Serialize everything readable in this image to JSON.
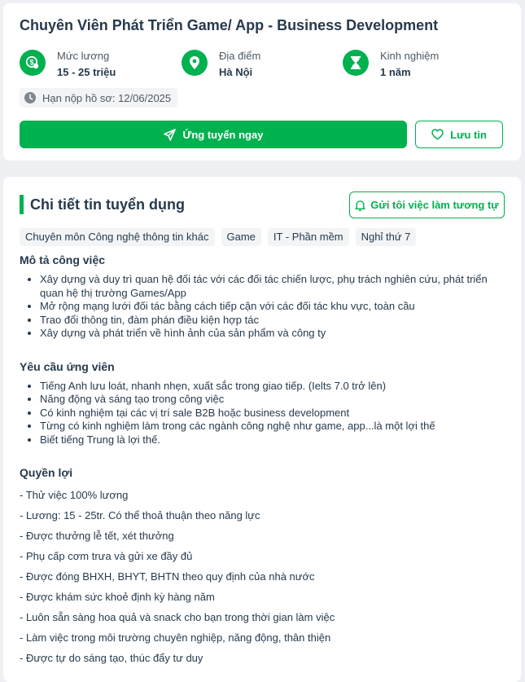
{
  "job": {
    "title": "Chuyên Viên Phát Triển Game/ App - Business Development",
    "salary_label": "Mức lương",
    "salary_value": "15 - 25 triệu",
    "location_label": "Địa điểm",
    "location_value": "Hà Nội",
    "experience_label": "Kinh nghiệm",
    "experience_value": "1 năm",
    "deadline": "Hạn nộp hồ sơ: 12/06/2025",
    "apply_label": "Ứng tuyển ngay",
    "save_label": "Lưu tin"
  },
  "detail": {
    "title": "Chi tiết tin tuyển dụng",
    "notify_label": "Gửi tôi việc làm tương tự",
    "tags": [
      "Chuyên môn Công nghệ thông tin khác",
      "Game",
      "IT - Phần mềm",
      "Nghỉ thứ 7"
    ],
    "description": {
      "heading": "Mô tả công việc",
      "items": [
        "Xây dựng và duy trì quan hệ đối tác với các đối tác chiến lược, phụ trách nghiên cứu, phát triển quan hệ thị trường Games/App",
        "Mở rộng mạng lưới đối tác bằng cách tiếp cận với các đối tác khu vực, toàn cầu",
        "Trao đổi thông tin, đàm phán điều kiện hợp tác",
        "Xây dựng và phát triển về hình ảnh của sản phẩm và công ty"
      ]
    },
    "requirements": {
      "heading": "Yêu cầu ứng viên",
      "items": [
        "Tiếng Anh lưu loát, nhanh nhẹn, xuất sắc trong giao tiếp. (Ielts 7.0 trở lên)",
        "Năng động và sáng tạo trong công việc",
        "Có kinh nghiệm tại các vị trí sale B2B hoặc business development",
        "Từng có kinh nghiệm làm trong các ngành công nghệ như game, app...là một lợi thế",
        "Biết tiếng Trung là lợi thế."
      ]
    },
    "benefits": {
      "heading": "Quyền lợi",
      "items": [
        "- Thử việc 100% lương",
        "- Lương: 15 - 25tr. Có thể thoả thuận theo năng lực",
        "- Được thưởng lễ tết, xét thưởng",
        "- Phụ cấp cơm trưa và gửi xe đầy đủ",
        "- Được đóng BHXH, BHYT, BHTN theo quy định của nhà nước",
        "- Được khám sức khoẻ định kỳ hàng năm",
        "- Luôn sẵn sàng hoa quả và snack cho bạn trong thời gian làm việc",
        "- Làm việc trong môi trường chuyên nghiệp, năng động, thân thiện",
        "- Được tự do sáng tạo, thúc đẩy tư duy"
      ]
    }
  },
  "icons": {
    "salary": "money-icon",
    "location": "map-pin-icon",
    "experience": "hourglass-icon",
    "deadline": "clock-icon",
    "apply": "paper-plane-icon",
    "save": "heart-icon",
    "notify": "bell-icon"
  },
  "colors": {
    "accent": "#00b14f",
    "text": "#263a4d",
    "muted": "#4d5965",
    "chip_bg": "#f2f4f5",
    "page_bg": "#eef0f3"
  }
}
